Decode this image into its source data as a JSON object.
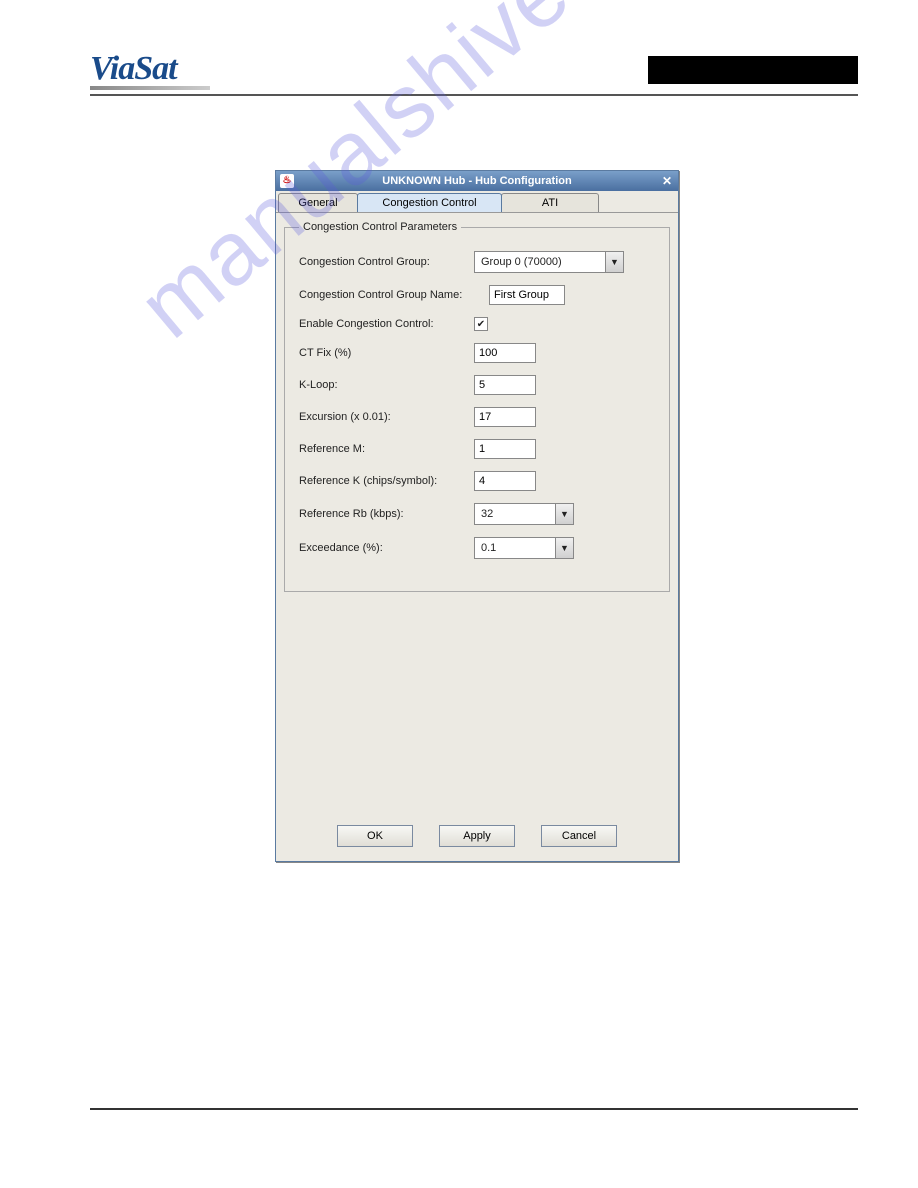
{
  "header": {
    "logo_text": "ViaSat"
  },
  "watermark": "manualshive.com",
  "dialog": {
    "title": "UNKNOWN Hub - Hub Configuration",
    "tabs": [
      {
        "label": "General"
      },
      {
        "label": "Congestion Control"
      },
      {
        "label": "ATI"
      }
    ],
    "fieldset_title": "Congestion Control Parameters",
    "fields": {
      "group_label": "Congestion Control Group:",
      "group_value": "Group 0 (70000)",
      "name_label": "Congestion Control Group Name:",
      "name_value": "First Group",
      "enable_label": "Enable Congestion Control:",
      "enable_checked": "✔",
      "ctfix_label": "CT Fix (%)",
      "ctfix_value": "100",
      "kloop_label": "K-Loop:",
      "kloop_value": "5",
      "excursion_label": "Excursion (x 0.01):",
      "excursion_value": "17",
      "refm_label": "Reference M:",
      "refm_value": "1",
      "refk_label": "Reference K (chips/symbol):",
      "refk_value": "4",
      "refrb_label": "Reference Rb (kbps):",
      "refrb_value": "32",
      "exceed_label": "Exceedance (%):",
      "exceed_value": "0.1"
    },
    "buttons": {
      "ok": "OK",
      "apply": "Apply",
      "cancel": "Cancel"
    }
  }
}
